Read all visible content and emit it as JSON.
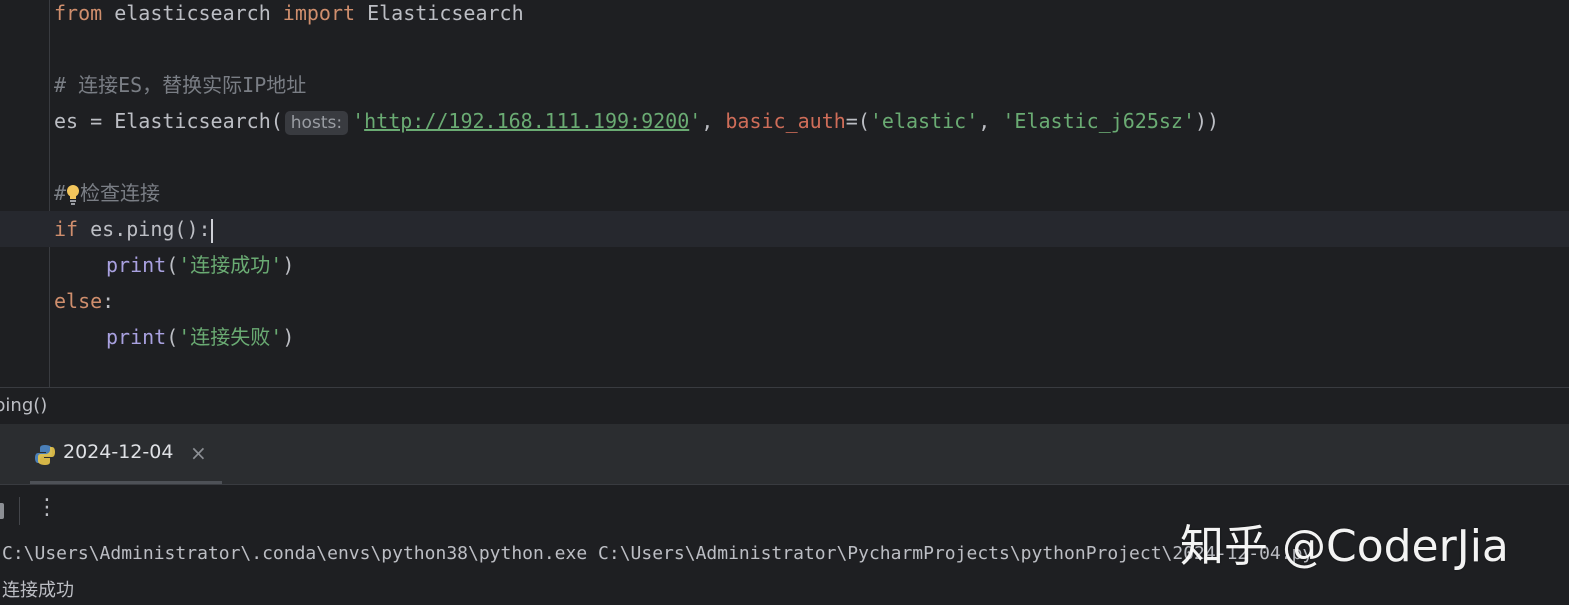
{
  "editor": {
    "line1": {
      "kw1": "from",
      "mod": " elasticsearch ",
      "kw2": "import",
      "cls": " Elasticsearch"
    },
    "line2": {
      "comment": "# 连接ES，替换实际IP地址"
    },
    "line3": {
      "pre": "es = Elasticsearch(",
      "hint": "hosts:",
      "q1": "'",
      "url": "http://192.168.111.199:9200",
      "q2": "'",
      "sep": ", ",
      "param": "basic_auth",
      "eq": "=(",
      "s1": "'elastic'",
      "sep2": ", ",
      "s2": "'Elastic_j625sz'",
      "close": "))"
    },
    "line4": {
      "hash": "#",
      "text": "检查连接"
    },
    "line5": {
      "kw": "if",
      "rest": " es.ping():"
    },
    "line6": {
      "fn": "print",
      "open": "(",
      "str": "'连接成功'",
      "close": ")"
    },
    "line7": {
      "kw": "else",
      "rest": ":"
    },
    "line8": {
      "fn": "print",
      "open": "(",
      "str": "'连接失败'",
      "close": ")"
    }
  },
  "breadcrumb": {
    "text": "ping()"
  },
  "run_panel": {
    "tab_label": "2024-12-04",
    "tab_icon": "python-icon",
    "close_glyph": "×"
  },
  "toolbar": {
    "more_glyph": "⋮"
  },
  "console": {
    "command": "C:\\Users\\Administrator\\.conda\\envs\\python38\\python.exe C:\\Users\\Administrator\\PycharmProjects\\pythonProject\\2024-12-04.py",
    "output": "连接成功"
  },
  "watermark": {
    "text": "知乎 @CoderJia"
  },
  "colors": {
    "background": "#1e1f22",
    "keyword": "#cf8e6d",
    "string": "#6aab73",
    "comment": "#7a7e85",
    "function": "#a9a1e0",
    "param": "#cf6d59"
  }
}
